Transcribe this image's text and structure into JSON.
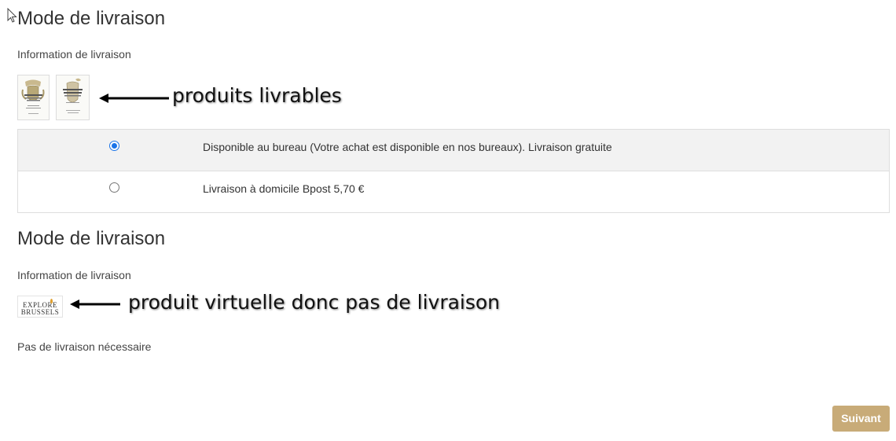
{
  "section1": {
    "title": "Mode de livraison",
    "info_label": "Information de livraison",
    "annotation": "produits livrables",
    "options": [
      {
        "label": "Disponible au bureau (Votre achat est disponible en nos bureaux). Livraison gratuite",
        "selected": true
      },
      {
        "label": "Livraison à domicile Bpost 5,70 €",
        "selected": false
      }
    ]
  },
  "section2": {
    "title": "Mode de livraison",
    "info_label": "Information de livraison",
    "annotation": "produit virtuelle donc pas de livraison",
    "logo_line1": "EXPLORE",
    "logo_line2": "BRUSSELS",
    "no_delivery_text": "Pas de livraison nécessaire"
  },
  "footer": {
    "next_label": "Suivant"
  },
  "colors": {
    "accent_button": "#c8ab78",
    "radio_selected": "#1a73e8",
    "selected_row_bg": "#f2f2f2"
  }
}
